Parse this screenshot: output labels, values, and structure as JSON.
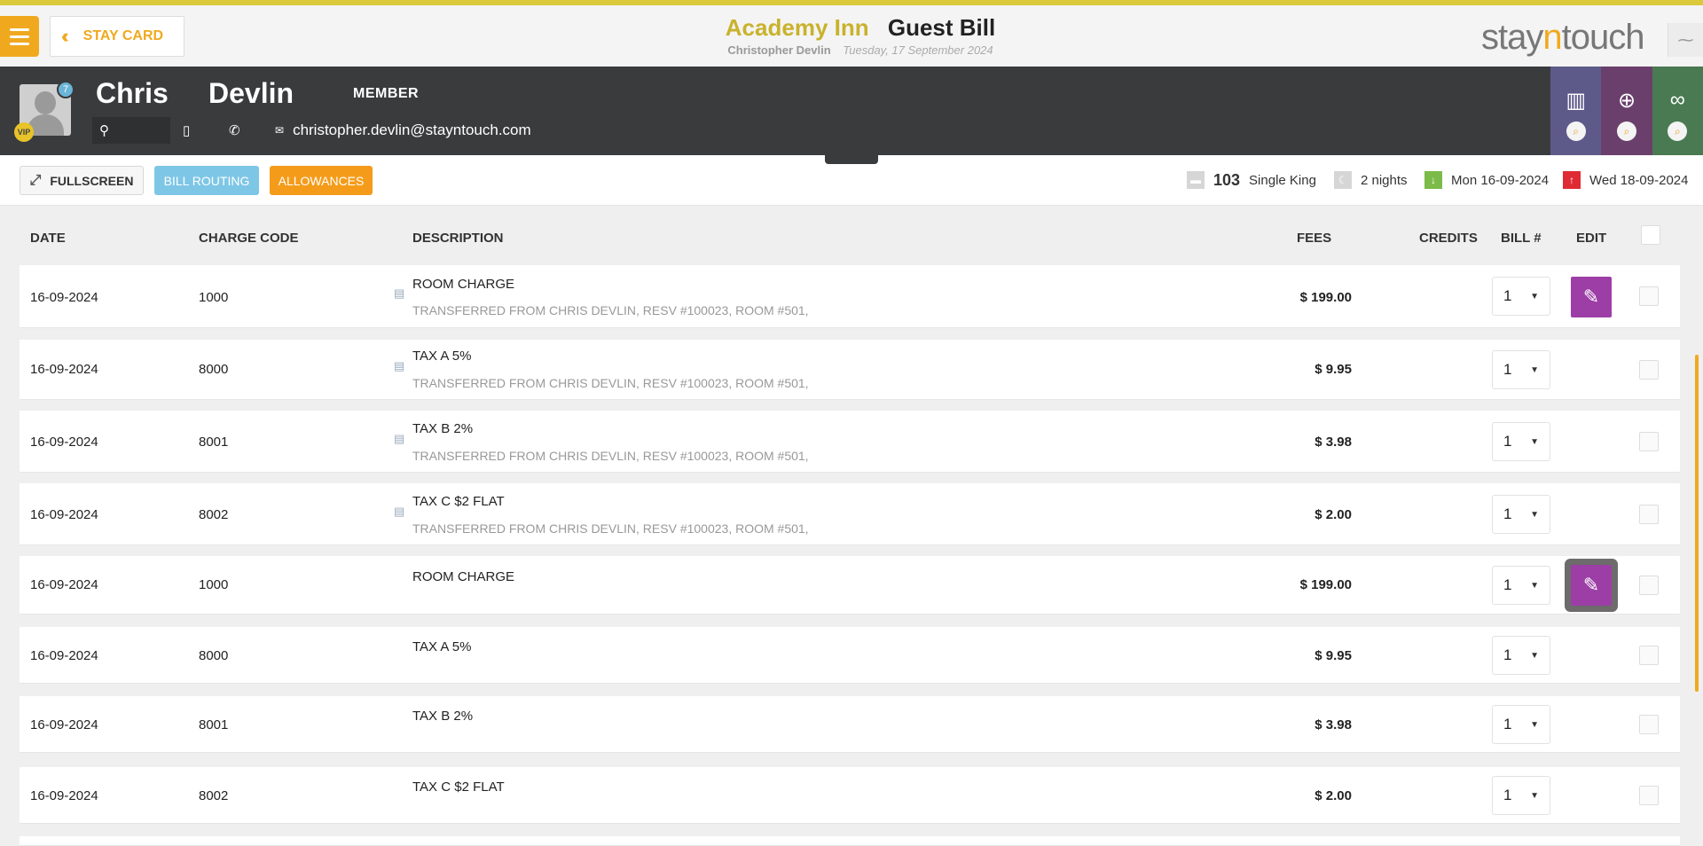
{
  "header": {
    "stay_card_label": "STAY CARD",
    "hotel": "Academy Inn",
    "page_title": "Guest Bill",
    "guest_name": "Christopher Devlin",
    "date": "Tuesday, 17 September 2024",
    "logo_pre": "stay",
    "logo_n": "n",
    "logo_post": "touch"
  },
  "guest": {
    "first_name": "Chris",
    "last_name": "Devlin",
    "status": "MEMBER",
    "vip": "VIP",
    "notifications": "7",
    "email": "christopher.devlin@stayntouch.com"
  },
  "toolbar": {
    "fullscreen": "FULLSCREEN",
    "bill_routing": "BILL ROUTING",
    "allowances": "ALLOWANCES"
  },
  "reservation": {
    "room_number": "103",
    "room_type": "Single King",
    "nights": "2 nights",
    "arrival": "Mon 16-09-2024",
    "departure": "Wed 18-09-2024"
  },
  "columns": {
    "date": "DATE",
    "charge_code": "CHARGE CODE",
    "description": "DESCRIPTION",
    "fees": "FEES",
    "credits": "CREDITS",
    "bill": "BILL #",
    "edit": "EDIT"
  },
  "rows": [
    {
      "date": "16-09-2024",
      "code": "1000",
      "desc": "ROOM CHARGE",
      "sub": "TRANSFERRED FROM CHRIS DEVLIN, RESV #100023, ROOM #501,",
      "fee": "$ 199.00",
      "bill": "1"
    },
    {
      "date": "16-09-2024",
      "code": "8000",
      "desc": "TAX A 5%",
      "sub": "TRANSFERRED FROM CHRIS DEVLIN, RESV #100023, ROOM #501,",
      "fee": "$ 9.95",
      "bill": "1"
    },
    {
      "date": "16-09-2024",
      "code": "8001",
      "desc": "TAX B 2%",
      "sub": "TRANSFERRED FROM CHRIS DEVLIN, RESV #100023, ROOM #501,",
      "fee": "$ 3.98",
      "bill": "1"
    },
    {
      "date": "16-09-2024",
      "code": "8002",
      "desc": "TAX C $2 FLAT",
      "sub": "TRANSFERRED FROM CHRIS DEVLIN, RESV #100023, ROOM #501,",
      "fee": "$ 2.00",
      "bill": "1"
    },
    {
      "date": "16-09-2024",
      "code": "1000",
      "desc": "ROOM CHARGE",
      "sub": "",
      "fee": "$ 199.00",
      "bill": "1"
    },
    {
      "date": "16-09-2024",
      "code": "8000",
      "desc": "TAX A 5%",
      "sub": "",
      "fee": "$ 9.95",
      "bill": "1"
    },
    {
      "date": "16-09-2024",
      "code": "8001",
      "desc": "TAX B 2%",
      "sub": "",
      "fee": "$ 3.98",
      "bill": "1"
    },
    {
      "date": "16-09-2024",
      "code": "8002",
      "desc": "TAX C $2 FLAT",
      "sub": "",
      "fee": "$ 2.00",
      "bill": "1"
    }
  ],
  "colors": {
    "accent": "#f0a91f",
    "edit_purple": "#9c3ea6",
    "routing_blue": "#7ec6e6",
    "allowances_orange": "#f49c1a"
  },
  "icons": {
    "menu": "hamburger-icon",
    "back": "double-chevron-left-icon",
    "location": "map-pin-icon",
    "mobile": "mobile-icon",
    "phone": "phone-icon",
    "email": "envelope-icon",
    "fullscreen": "expand-icon",
    "edit": "pencil-icon"
  }
}
